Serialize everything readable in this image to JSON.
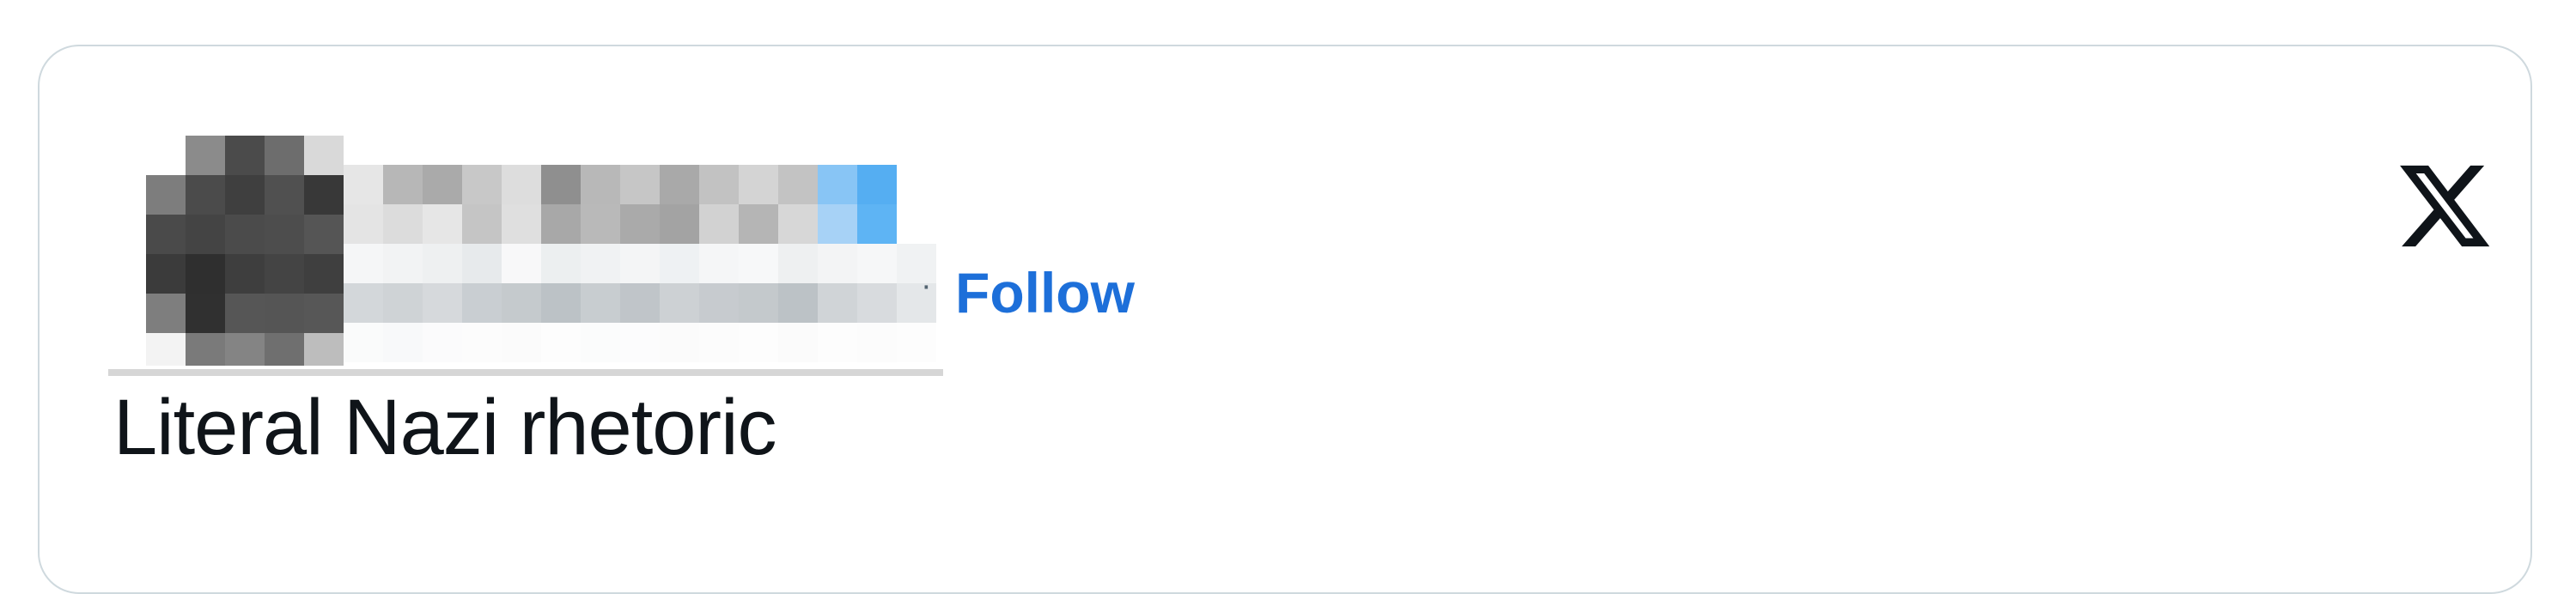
{
  "tweet": {
    "follow_label": "Follow",
    "separator": "·",
    "text": "Literal Nazi rhetoric",
    "platform_icon": "x-logo-icon"
  },
  "colors": {
    "follow": "#1d6fd9",
    "text": "#0f1419",
    "border": "#cfd9de",
    "separator": "#536471"
  }
}
